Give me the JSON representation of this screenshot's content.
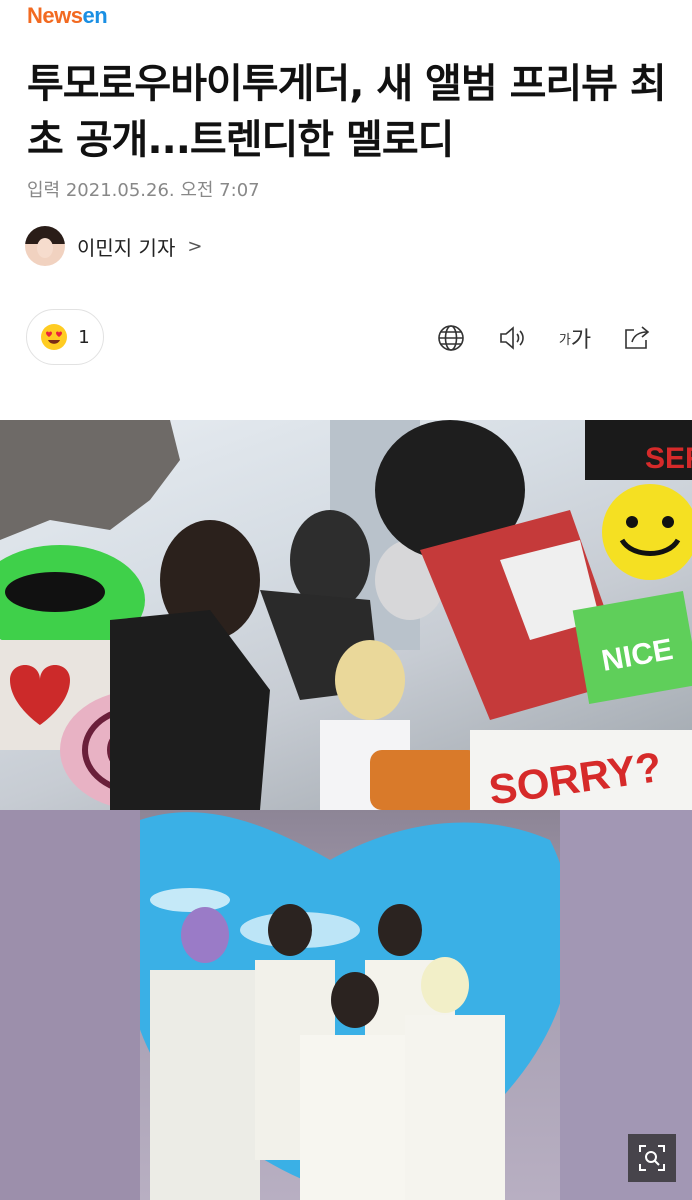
{
  "header": {
    "logo_part1": "News",
    "logo_part2": "en"
  },
  "article": {
    "title": "투모로우바이투게더, 새 앨범 프리뷰 최초 공개...트렌디한 멜로디",
    "date": "입력 2021.05.26. 오전 7:07",
    "reporter": "이민지 기자",
    "reporter_chevron": ">"
  },
  "toolbar": {
    "reaction_count": "1",
    "font_small": "가",
    "font_large": "가",
    "icons": [
      "heart-eyes-emoji-icon",
      "globe-icon",
      "speaker-icon",
      "font-size-icon",
      "share-icon"
    ]
  },
  "photos": {
    "photo1_stickers": [
      "SORRY?",
      "NICE",
      "SER"
    ],
    "zoom_icon": "zoom-search-icon"
  },
  "colors": {
    "logo_orange": "#f26a21",
    "logo_blue": "#1a8fe3",
    "sticker_red": "#d62a2a",
    "sticker_green": "#3fd04a",
    "sticker_yellow": "#f5e022"
  }
}
